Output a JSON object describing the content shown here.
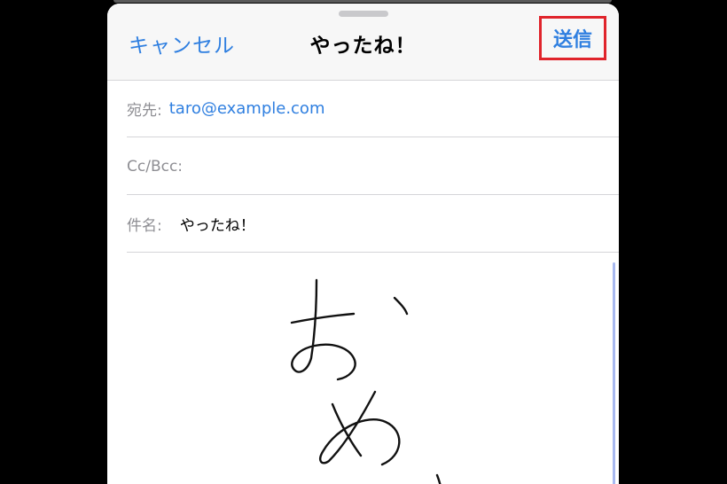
{
  "nav": {
    "cancel_label": "キャンセル",
    "title": "やったね！",
    "send_label": "送信"
  },
  "fields": {
    "to_label": "宛先:",
    "to_value": "taro@example.com",
    "cc_label": "Cc/Bcc:",
    "subject_label": "件名:",
    "subject_value": "やったね！"
  },
  "body": {
    "content_type": "handwritten-sketch"
  },
  "colors": {
    "accent": "#2f7fe0",
    "highlight_border": "#e0242b",
    "label_gray": "#8e8e93"
  },
  "icons": {
    "grabber": "sheet-grabber-icon"
  }
}
